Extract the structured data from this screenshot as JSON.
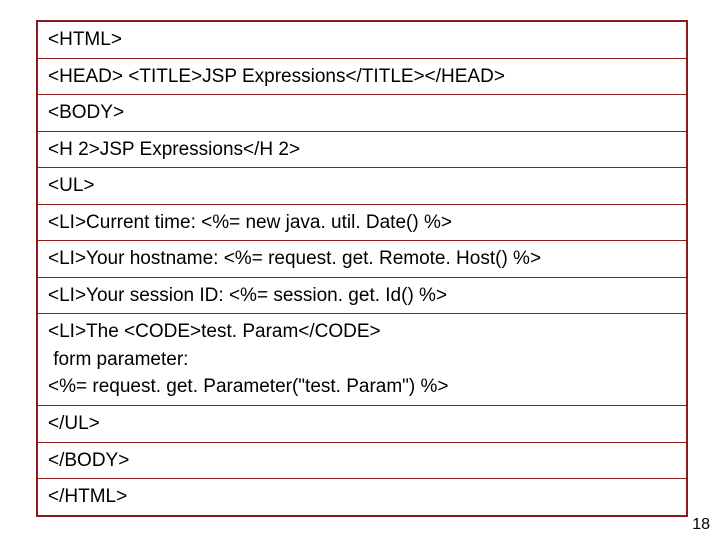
{
  "rows": [
    "<HTML>",
    "<HEAD> <TITLE>JSP Expressions</TITLE></HEAD>",
    "<BODY>",
    "<H 2>JSP Expressions</H 2>",
    "<UL>",
    "<LI>Current time: <%= new java. util. Date() %>",
    "<LI>Your hostname: <%= request. get. Remote. Host() %>",
    "<LI>Your session ID: <%= session. get. Id() %>",
    "<LI>The <CODE>test. Param</CODE>\n form parameter:\n<%= request. get. Parameter(\"test. Param\") %>",
    "</UL>",
    "</BODY>",
    "</HTML>"
  ],
  "page_number": "18"
}
